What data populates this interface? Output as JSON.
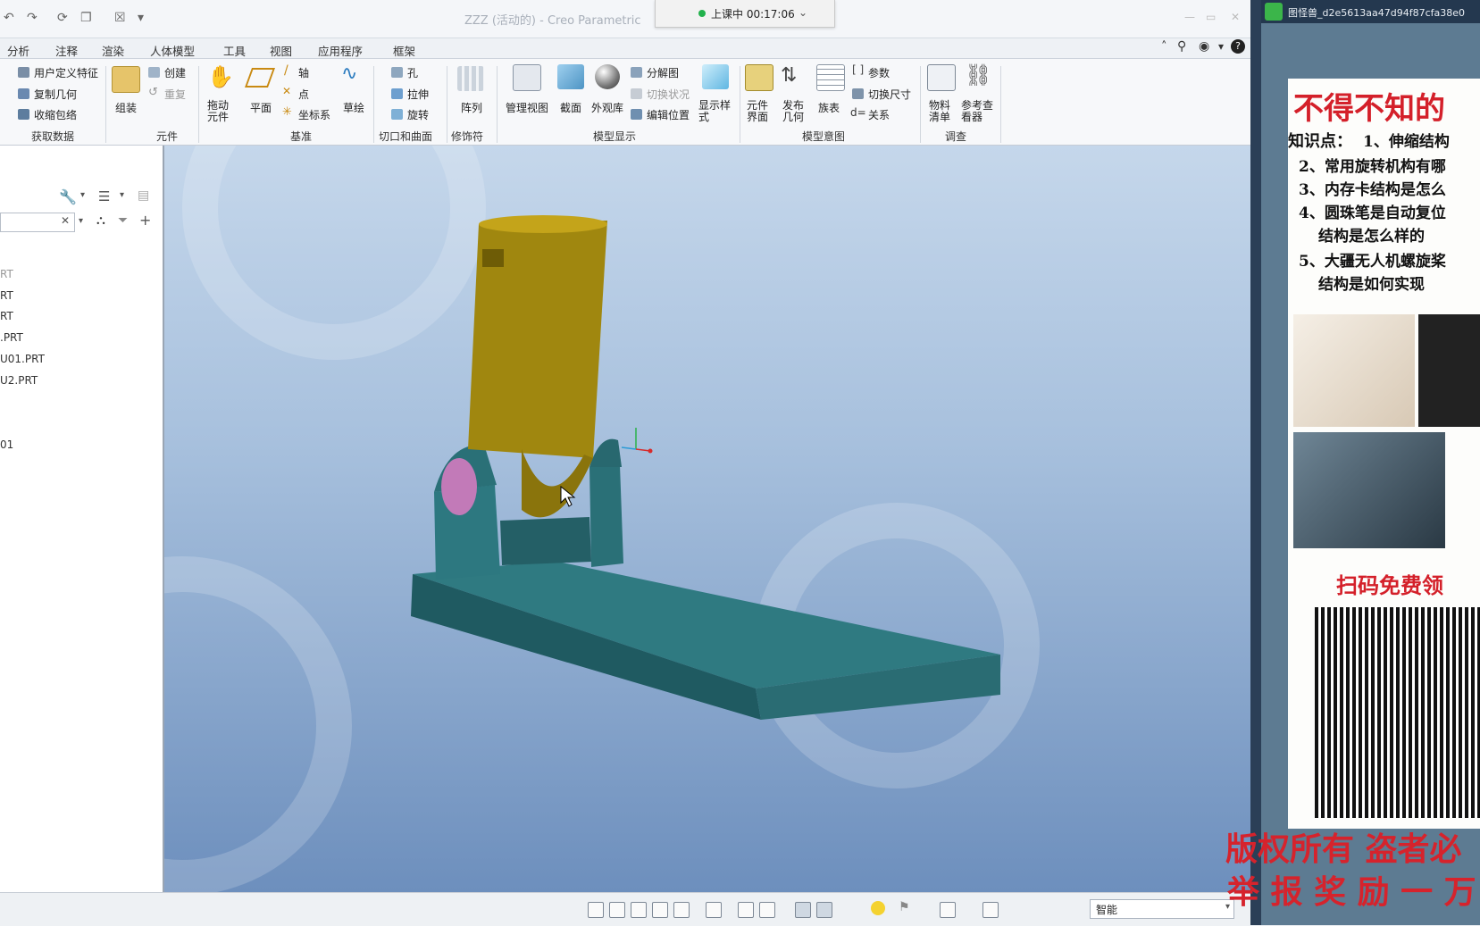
{
  "window": {
    "title": "ZZZ (活动的) - Creo Parametric",
    "live_status": "上课中 00:17:06"
  },
  "menu": [
    "分析",
    "注释",
    "渲染",
    "人体模型",
    "工具",
    "视图",
    "应用程序",
    "框架"
  ],
  "ribbon": {
    "get_data": {
      "items": [
        "用户定义特征",
        "复制几何",
        "收缩包络"
      ],
      "label": "获取数据"
    },
    "component": {
      "assemble": "组装",
      "create": "创建",
      "repeat": "重复",
      "label": "元件"
    },
    "datum": {
      "drag": "拖动元件",
      "plane": "平面",
      "axis": "轴",
      "point": "点",
      "csys": "坐标系",
      "sketch": "草绘",
      "label": "基准"
    },
    "cut_surface": {
      "hole": "孔",
      "extrude": "拉伸",
      "revolve": "旋转",
      "label": "切口和曲面"
    },
    "modifier": {
      "pattern": "阵列",
      "label": "修饰符"
    },
    "model_display": {
      "manage_views": "管理视图",
      "section": "截面",
      "appearance": "外观库",
      "exploded": "分解图",
      "toggle_state": "切换状况",
      "edit_position": "编辑位置",
      "display_style": "显示样式",
      "label": "模型显示"
    },
    "model_intent": {
      "component_interface": "元件界面",
      "publish_geometry": "发布几何",
      "family_table": "族表",
      "params": "参数",
      "switch_dims": "切换尺寸",
      "relations": "关系",
      "label": "模型意图"
    },
    "investigate": {
      "bom": "物料清单",
      "ref_viewer": "参考查看器",
      "label": "调查"
    }
  },
  "tree": [
    "RT",
    "RT",
    "RT",
    ".PRT",
    "U01.PRT",
    "U2.PRT",
    "01"
  ],
  "status": {
    "filter": "智能"
  },
  "right_window": {
    "title": "图怪兽_d2e5613aa47d94f87cfa38e0"
  },
  "poster": {
    "headline": "不得不知的",
    "knowledge_label": "知识点：",
    "points": [
      "1、伸缩结构",
      "2、常用旋转机构有哪",
      "3、内存卡结构是怎么",
      "4、圆珠笔是自动复位",
      "结构是怎么样的",
      "5、大疆无人机螺旋桨",
      "结构是如何实现"
    ],
    "cta": "扫码免费领"
  },
  "watermark": {
    "line1": "版权所有 盗者必",
    "line2": "举 报 奖 励 一 万"
  },
  "colors": {
    "cup": "#a0870f",
    "base": "#2f7a81",
    "pin": "#c27ab8",
    "viewport_top": "#c5d7eb",
    "viewport_bottom": "#6d8fbd"
  }
}
